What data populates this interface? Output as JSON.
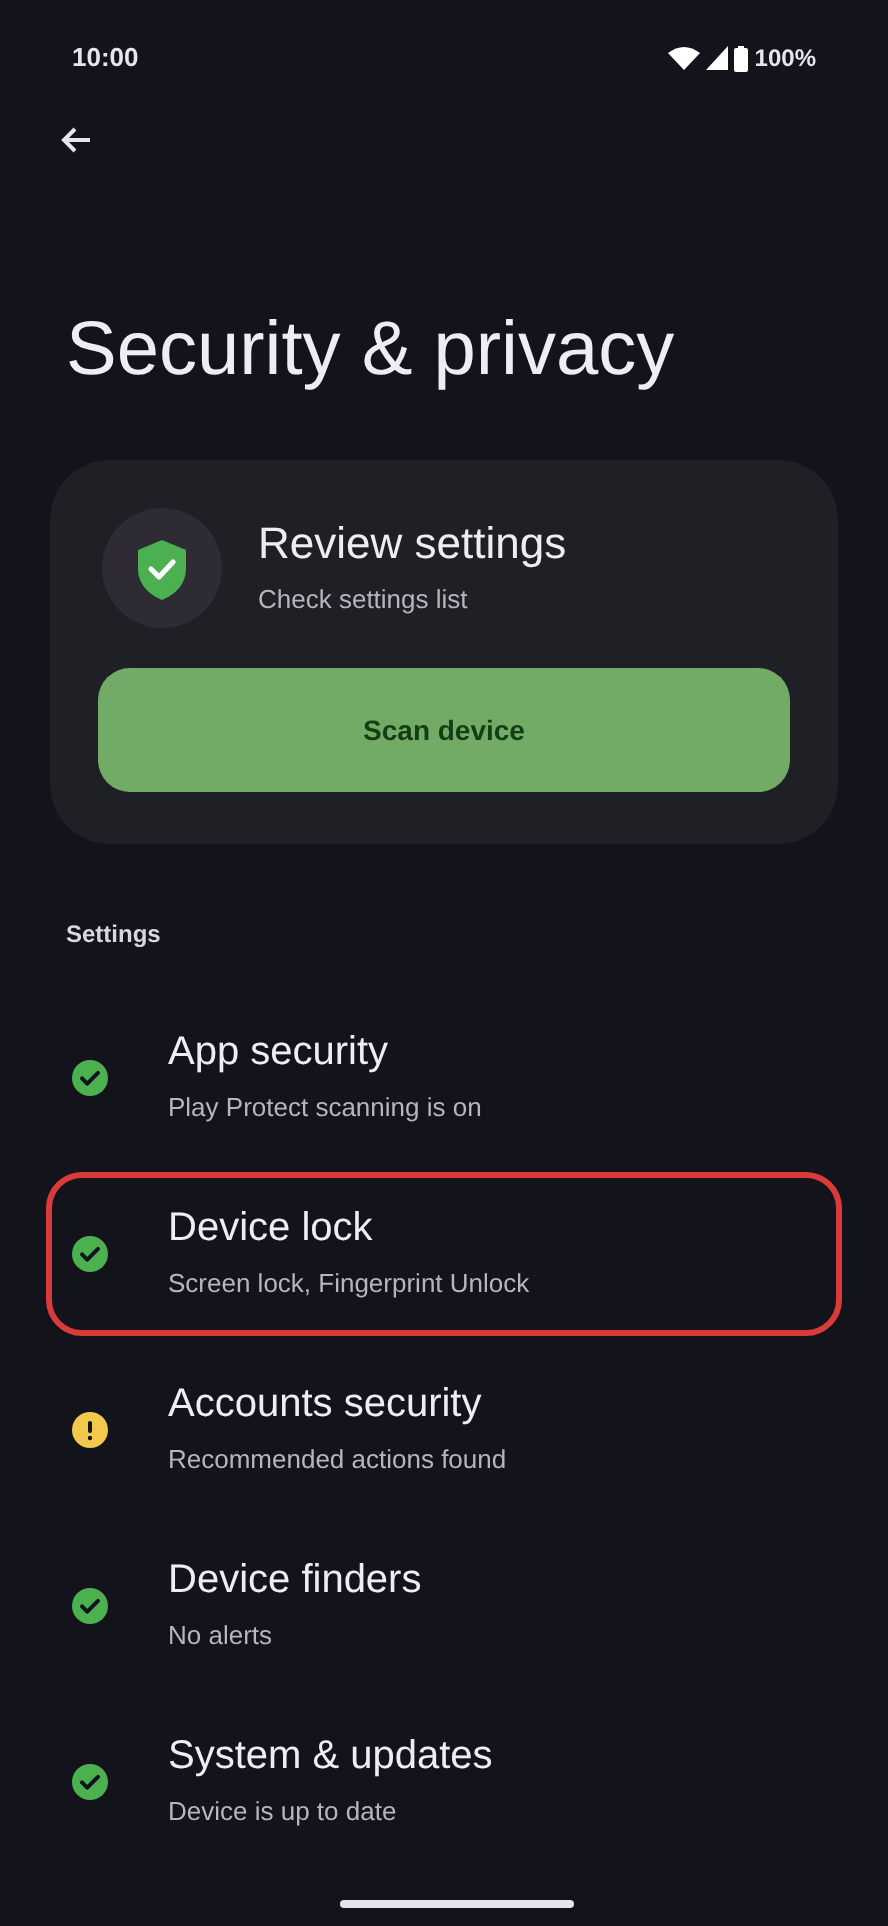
{
  "status_bar": {
    "time": "10:00",
    "battery": "100%"
  },
  "title": "Security & privacy",
  "card": {
    "title": "Review settings",
    "subtitle": "Check settings list",
    "button": "Scan device"
  },
  "section_label": "Settings",
  "items": [
    {
      "title": "App security",
      "subtitle": "Play Protect scanning is on",
      "kind": "ok",
      "color": "#4caf50",
      "highlighted": false
    },
    {
      "title": "Device lock",
      "subtitle": "Screen lock, Fingerprint Unlock",
      "kind": "ok",
      "color": "#4caf50",
      "highlighted": true
    },
    {
      "title": "Accounts security",
      "subtitle": "Recommended actions found",
      "kind": "warning",
      "color": "#f2c94c",
      "highlighted": false
    },
    {
      "title": "Device finders",
      "subtitle": "No alerts",
      "kind": "ok",
      "color": "#4caf50",
      "highlighted": false
    },
    {
      "title": "System & updates",
      "subtitle": "Device is up to date",
      "kind": "ok",
      "color": "#4caf50",
      "highlighted": false
    }
  ]
}
